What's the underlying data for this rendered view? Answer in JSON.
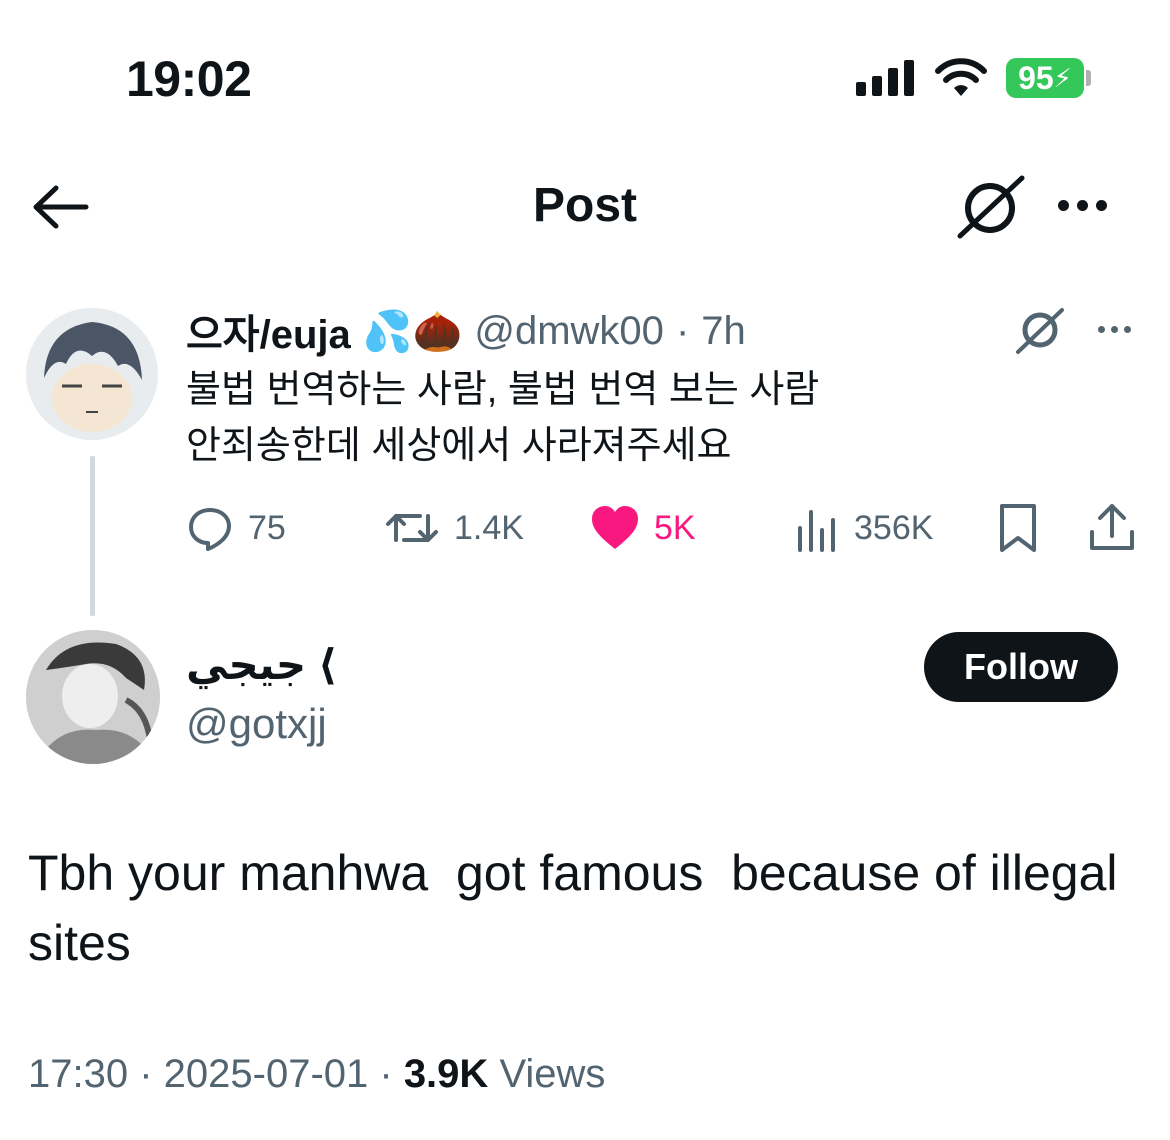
{
  "status_bar": {
    "time": "19:02",
    "battery": "95"
  },
  "header": {
    "title": "Post",
    "grok_icon": "grok-icon",
    "more_icon": "more-icon"
  },
  "quoted": {
    "display_name": "으자/euja",
    "emoji": "💦🌰",
    "handle": "@dmwk00",
    "time": "7h",
    "text_line1": "불법 번역하는 사람, 불법 번역 보는 사람",
    "text_line2": "안죄송한데 세상에서 사라져주세요",
    "replies": "75",
    "reposts": "1.4K",
    "likes": "5K",
    "views": "356K",
    "like_color": "#f91880"
  },
  "post": {
    "display_name": "جيجي ⟨",
    "handle": "@gotxjj",
    "follow_label": "Follow",
    "text": "Tbh your manhwa  got famous  because of illegal sites",
    "time": "17:30",
    "date": "2025-07-01",
    "views_count": "3.9K",
    "views_label": "Views"
  }
}
